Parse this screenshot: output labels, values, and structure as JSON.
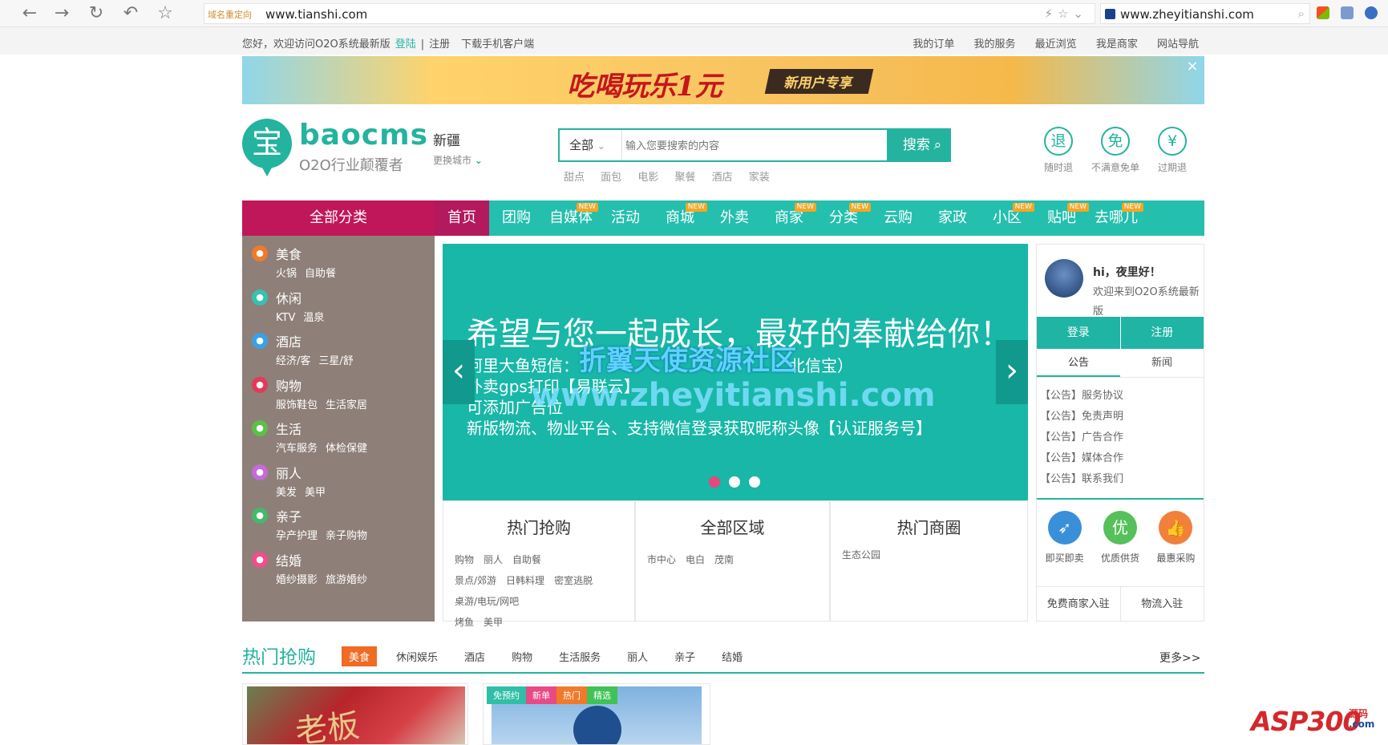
{
  "browser": {
    "back_icon": "arrow-left",
    "forward_icon": "arrow-right",
    "reload_icon": "reload",
    "undo_icon": "undo",
    "bookmark_icon": "star",
    "addr_tag": "域名重定向",
    "url": "www.tianshi.com",
    "second_url": "www.zheyitianshi.com"
  },
  "topbar": {
    "greeting": "您好，欢迎访问O2O系统最新版",
    "login": "登陆",
    "register": "注册",
    "sep": "|",
    "download": "下载手机客户端",
    "links": [
      "我的订单",
      "我的服务",
      "最近浏览",
      "我是商家",
      "网站导航"
    ]
  },
  "banner": {
    "headline": "吃喝玩乐1元",
    "pill": "新用户专享",
    "close": "×"
  },
  "header": {
    "logo_char": "宝",
    "logo_name": "baocms",
    "logo_slogan": "O2O行业颠覆者",
    "city": "新疆",
    "city_switch": "更换城市",
    "search": {
      "category": "全部",
      "placeholder": "输入您要搜索的内容",
      "button": "搜索",
      "hot_words": [
        "甜点",
        "面包",
        "电影",
        "聚餐",
        "酒店",
        "家装"
      ]
    },
    "services": [
      {
        "char": "退",
        "label": "随时退"
      },
      {
        "char": "免",
        "label": "不满意免单"
      },
      {
        "char": "¥",
        "label": "过期退"
      }
    ]
  },
  "nav": {
    "all": "全部分类",
    "new_badge": "NEW",
    "items": [
      {
        "label": "首页",
        "new": false
      },
      {
        "label": "团购",
        "new": false
      },
      {
        "label": "自媒体",
        "new": true
      },
      {
        "label": "活动",
        "new": false
      },
      {
        "label": "商城",
        "new": true
      },
      {
        "label": "外卖",
        "new": false
      },
      {
        "label": "商家",
        "new": true
      },
      {
        "label": "分类",
        "new": true
      },
      {
        "label": "云购",
        "new": false
      },
      {
        "label": "家政",
        "new": false
      },
      {
        "label": "小区",
        "new": true
      },
      {
        "label": "贴吧",
        "new": true
      },
      {
        "label": "去哪儿",
        "new": true
      }
    ]
  },
  "categories": [
    {
      "name": "美食",
      "subs": [
        "火锅",
        "自助餐"
      ],
      "color": "#f07a2a"
    },
    {
      "name": "休闲",
      "subs": [
        "KTV",
        "温泉"
      ],
      "color": "#35c2b0"
    },
    {
      "name": "酒店",
      "subs": [
        "经济/客",
        "三星/舒"
      ],
      "color": "#3aa0e8"
    },
    {
      "name": "购物",
      "subs": [
        "服饰鞋包",
        "生活家居"
      ],
      "color": "#e23a5a"
    },
    {
      "name": "生活",
      "subs": [
        "汽车服务",
        "体检保健"
      ],
      "color": "#5cbf4a"
    },
    {
      "name": "丽人",
      "subs": [
        "美发",
        "美甲"
      ],
      "color": "#c46bd9"
    },
    {
      "name": "亲子",
      "subs": [
        "孕产护理",
        "亲子购物"
      ],
      "color": "#46b86c"
    },
    {
      "name": "结婚",
      "subs": [
        "婚纱摄影",
        "旅游婚纱"
      ],
      "color": "#ef4f8d"
    }
  ],
  "slider": {
    "title": "希望与您一起成长，最好的奉献给你！",
    "lines": [
      "阿里大鱼短信：",
      "外卖gps打印【易联云】",
      "可添加广告位",
      "新版物流、物业平台、支持微信登录获取昵称头像【认证服务号】"
    ],
    "line1_tail": "北信宝）",
    "watermark1": "折翼天使资源社区",
    "watermark2": "www.zheyitianshi.com",
    "prev": "‹",
    "next": "›"
  },
  "panels": [
    {
      "title": "热门抢购",
      "items": [
        "购物",
        "丽人",
        "自助餐",
        "景点/郊游",
        "日韩料理",
        "密室逃脱",
        "桌游/电玩/网吧",
        "烤鱼",
        "美甲"
      ]
    },
    {
      "title": "全部区域",
      "items": [
        "市中心",
        "电白",
        "茂南"
      ]
    },
    {
      "title": "热门商圈",
      "items": [
        "生态公园"
      ]
    }
  ],
  "user": {
    "hi": "hi，夜里好！",
    "welcome": "欢迎来到O2O系统最新版",
    "login": "登录",
    "register": "注册",
    "tabs": [
      "公告",
      "新闻"
    ],
    "notices": [
      "【公告】服务协议",
      "【公告】免责声明",
      "【公告】广告合作",
      "【公告】媒体合作",
      "【公告】联系我们"
    ],
    "features": [
      {
        "label": "即买即卖",
        "color": "#3a8fd9",
        "char": "➶"
      },
      {
        "label": "优质供货",
        "color": "#56c05a",
        "char": "优"
      },
      {
        "label": "最惠采购",
        "color": "#f0803a",
        "char": "👍"
      }
    ],
    "links": [
      "免费商家入驻",
      "物流入驻"
    ]
  },
  "hot": {
    "title": "热门抢购",
    "tabs": [
      "美食",
      "休闲娱乐",
      "酒店",
      "购物",
      "生活服务",
      "丽人",
      "亲子",
      "结婚"
    ],
    "more": "更多>>",
    "badges": [
      {
        "label": "免预约",
        "color": "#2fbfa6"
      },
      {
        "label": "新单",
        "color": "#e84a86"
      },
      {
        "label": "热门",
        "color": "#f07a2a"
      },
      {
        "label": "精选",
        "color": "#3fc256"
      }
    ]
  },
  "watermark": {
    "brand": "ASP300",
    "tag": "源码",
    "suffix": ".com"
  }
}
